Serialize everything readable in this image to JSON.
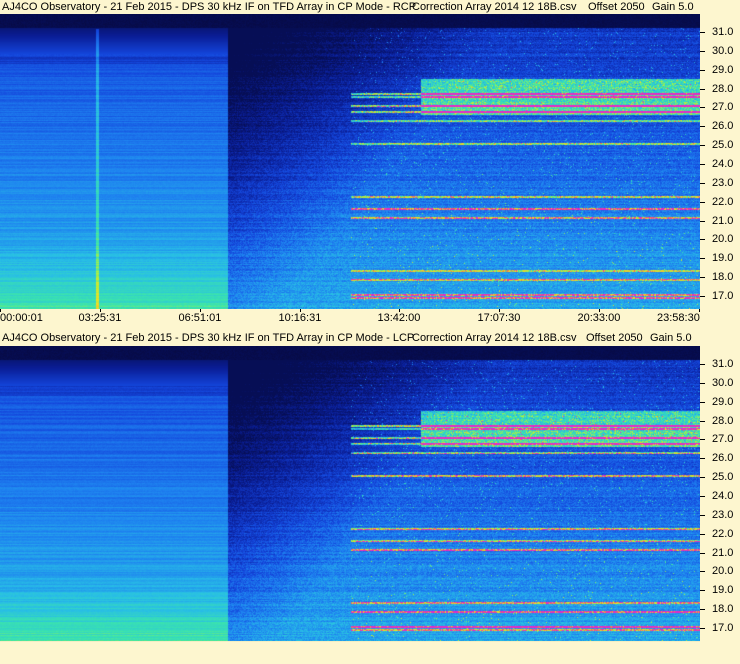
{
  "panels": [
    {
      "id": "rcp",
      "title": "AJ4CO Observatory - 21 Feb 2015 - DPS 30 kHz IF on TFD Array in CP Mode - RCP",
      "correction": "Correction Array 2014 12 18B.csv",
      "offset": "Offset 2050",
      "gain": "Gain 5.0",
      "x_labels": [
        "00:00:01",
        "03:25:31",
        "06:51:01",
        "10:16:31",
        "13:42:00",
        "17:07:30",
        "20:33:00",
        "23:58:30"
      ],
      "y_labels": [
        "31.0",
        "30.0",
        "29.0",
        "28.0",
        "27.0",
        "26.0",
        "25.0",
        "24.0",
        "23.0",
        "22.0",
        "21.0",
        "20.0",
        "19.0",
        "18.0",
        "17.0"
      ]
    },
    {
      "id": "lcp",
      "title": "AJ4CO Observatory - 21 Feb 2015 - DPS 30 kHz IF on TFD Array in CP Mode - LCP",
      "correction": "Correction Array 2014 12 18B.csv",
      "offset": "Offset 2050",
      "gain": "Gain 5.0",
      "y_labels": [
        "31.0",
        "30.0",
        "29.0",
        "28.0",
        "27.0",
        "26.0",
        "25.0",
        "24.0",
        "23.0",
        "22.0",
        "21.0",
        "20.0",
        "19.0",
        "18.0",
        "17.0"
      ]
    }
  ]
}
